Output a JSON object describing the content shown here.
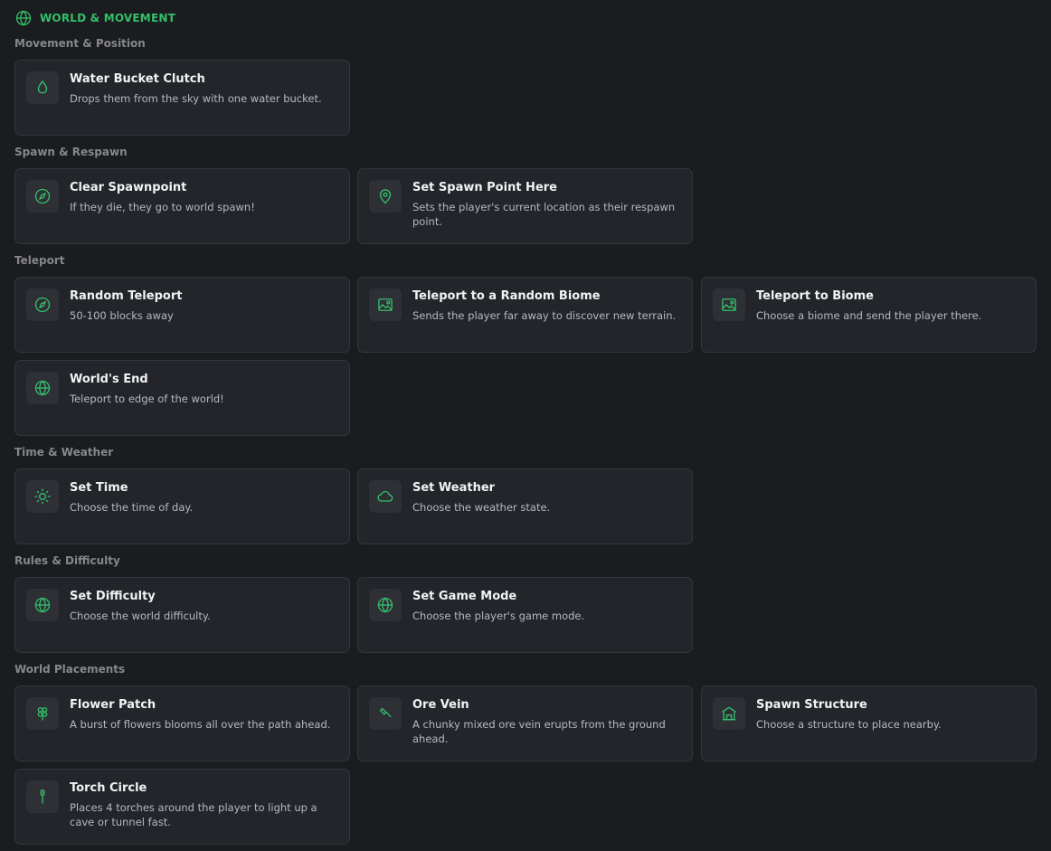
{
  "header": {
    "title": "WORLD & MOVEMENT",
    "icon": "globe-icon",
    "accent": "#33c06a"
  },
  "sections": {
    "movement": {
      "label": "Movement & Position",
      "cards": [
        {
          "title": "Water Bucket Clutch",
          "description": "Drops them from the sky with one water bucket.",
          "icon": "droplet-icon"
        }
      ]
    },
    "spawn": {
      "label": "Spawn & Respawn",
      "cards": [
        {
          "title": "Clear Spawnpoint",
          "description": "If they die, they go to world spawn!",
          "icon": "compass-icon"
        },
        {
          "title": "Set Spawn Point Here",
          "description": "Sets the player's current location as their respawn point.",
          "icon": "map-pin-icon"
        }
      ]
    },
    "teleport": {
      "label": "Teleport",
      "cards": [
        {
          "title": "Random Teleport",
          "description": "50-100 blocks away",
          "icon": "compass-icon"
        },
        {
          "title": "Teleport to a Random Biome",
          "description": "Sends the player far away to discover new terrain.",
          "icon": "image-icon"
        },
        {
          "title": "Teleport to Biome",
          "description": "Choose a biome and send the player there.",
          "icon": "image-icon"
        },
        {
          "title": "World's End",
          "description": "Teleport to edge of the world!",
          "icon": "globe-icon"
        }
      ]
    },
    "time": {
      "label": "Time & Weather",
      "cards": [
        {
          "title": "Set Time",
          "description": "Choose the time of day.",
          "icon": "sun-icon"
        },
        {
          "title": "Set Weather",
          "description": "Choose the weather state.",
          "icon": "cloud-icon"
        }
      ]
    },
    "rules": {
      "label": "Rules & Difficulty",
      "cards": [
        {
          "title": "Set Difficulty",
          "description": "Choose the world difficulty.",
          "icon": "globe-icon"
        },
        {
          "title": "Set Game Mode",
          "description": "Choose the player's game mode.",
          "icon": "globe-icon"
        }
      ]
    },
    "placements": {
      "label": "World Placements",
      "cards": [
        {
          "title": "Flower Patch",
          "description": "A burst of flowers blooms all over the path ahead.",
          "icon": "flower-icon"
        },
        {
          "title": "Ore Vein",
          "description": "A chunky mixed ore vein erupts from the ground ahead.",
          "icon": "pickaxe-icon"
        },
        {
          "title": "Spawn Structure",
          "description": "Choose a structure to place nearby.",
          "icon": "house-icon"
        },
        {
          "title": "Torch Circle",
          "description": "Places 4 torches around the player to light up a cave or tunnel fast.",
          "icon": "torch-icon"
        }
      ]
    }
  }
}
